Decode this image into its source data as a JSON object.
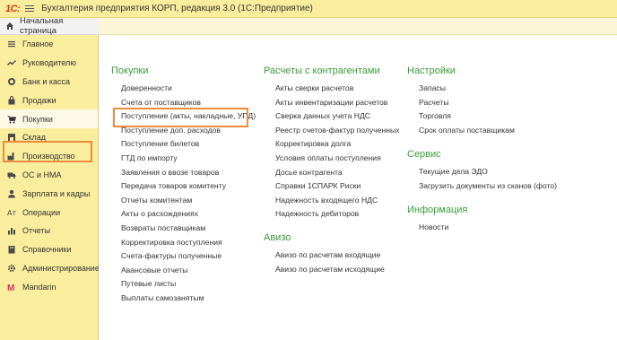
{
  "titlebar": {
    "logo": "1С:",
    "title": "Бухгалтерия предприятия КОРП, редакция 3.0  (1С:Предприятие)"
  },
  "homebar": {
    "label": "Начальная страница"
  },
  "sidebar": {
    "items": [
      {
        "label": "Главное",
        "icon": "menu-icon"
      },
      {
        "label": "Руководителю",
        "icon": "trend-icon"
      },
      {
        "label": "Банк и касса",
        "icon": "coins-icon"
      },
      {
        "label": "Продажи",
        "icon": "bag-icon"
      },
      {
        "label": "Покупки",
        "icon": "cart-icon"
      },
      {
        "label": "Склад",
        "icon": "warehouse-icon"
      },
      {
        "label": "Производство",
        "icon": "factory-icon"
      },
      {
        "label": "ОС и НМА",
        "icon": "truck-icon"
      },
      {
        "label": "Зарплата и кадры",
        "icon": "person-icon"
      },
      {
        "label": "Операции",
        "icon": "operations-icon"
      },
      {
        "label": "Отчеты",
        "icon": "bar-chart-icon"
      },
      {
        "label": "Справочники",
        "icon": "book-icon"
      },
      {
        "label": "Администрирование",
        "icon": "gear-icon"
      },
      {
        "label": "Mandarin",
        "icon": "mandarin-logo-icon"
      }
    ],
    "active_index": 4,
    "highlight_color": "#f08a3c"
  },
  "main": {
    "col1": {
      "title": "Покупки",
      "links": [
        "Доверенности",
        "Счета от поставщиков",
        "Поступление (акты, накладные, УПД)",
        "Поступление доп. расходов",
        "Поступление билетов",
        "ГТД по импорту",
        "Заявления о ввозе товаров",
        "Передача товаров комитенту",
        "Отчеты комитентам",
        "Акты о расхождениях",
        "Возвраты поставщикам",
        "Корректировка поступления",
        "Счета-фактуры полученные",
        "Авансовые отчеты",
        "Путевые листы",
        "Выплаты самозанятым"
      ]
    },
    "col2": {
      "title": "Расчеты с контрагентами",
      "links": [
        "Акты сверки расчетов",
        "Акты инвентаризации расчетов",
        "Сверка данных учета НДС",
        "Реестр счетов-фактур полученных",
        "Корректировка долга",
        "Условия оплаты поступления",
        "Досье контрагента",
        "Справки 1СПАРК Риски",
        "Надежность входящего НДС",
        "Надежность дебиторов"
      ],
      "title2": "Авизо",
      "links2": [
        "Авизо по расчетам входящие",
        "Авизо по расчетам исходящие"
      ]
    },
    "col3": {
      "title": "Настройки",
      "links": [
        "Запасы",
        "Расчеты",
        "Торговля",
        "Срок оплаты поставщикам"
      ],
      "title2": "Сервис",
      "links2": [
        "Текущие дела ЭДО",
        "Загрузить документы из сканов (фото)"
      ],
      "title3": "Информация",
      "links3": [
        "Новости"
      ]
    },
    "section_title_color": "#3b9c3b"
  }
}
